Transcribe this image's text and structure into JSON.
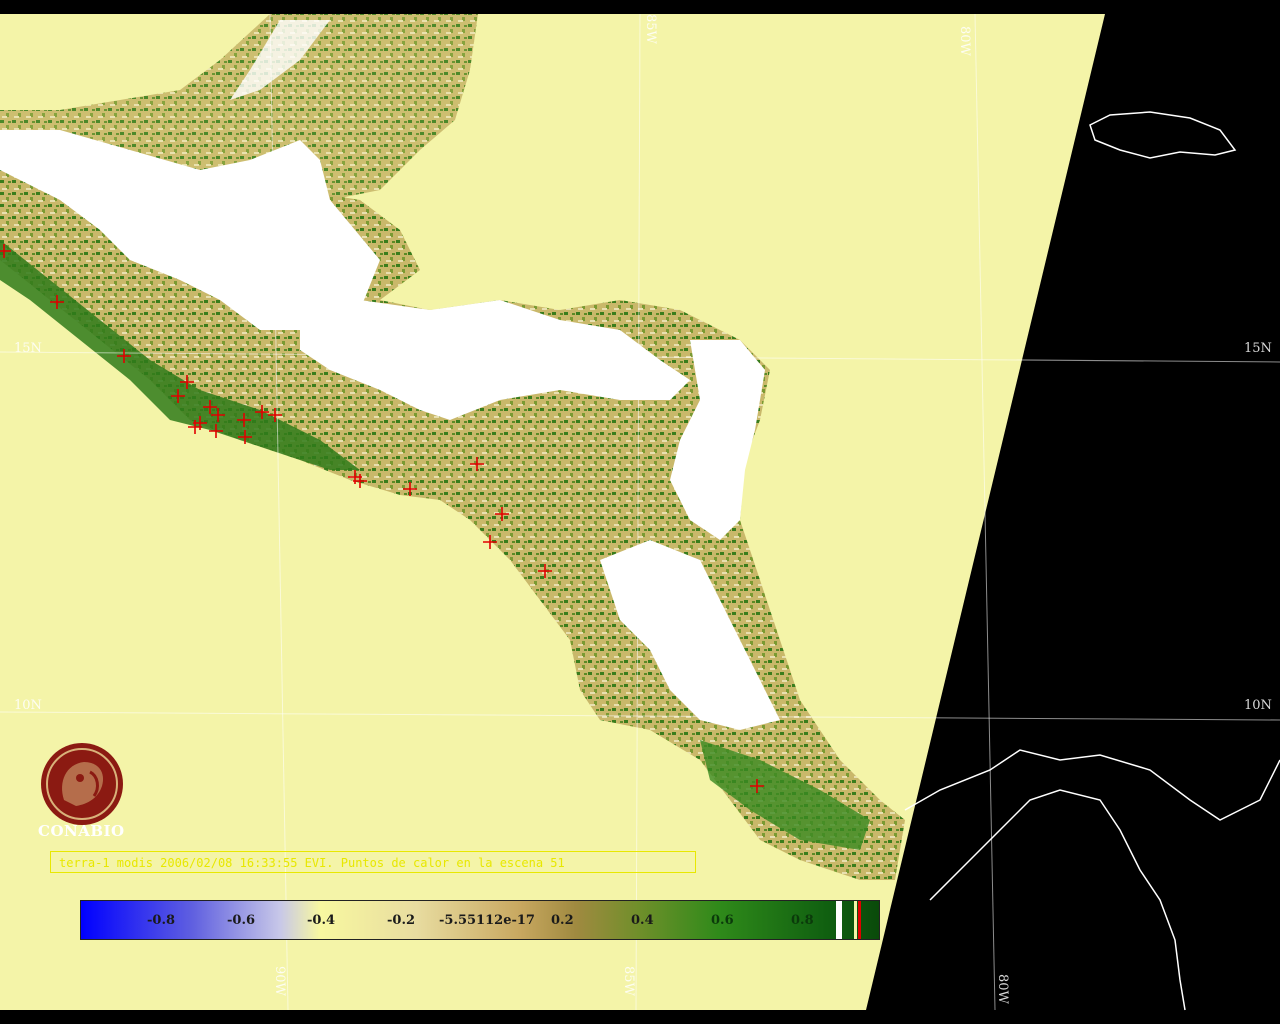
{
  "map": {
    "lat_labels": [
      "15N",
      "15N",
      "10N",
      "10N"
    ],
    "lon_labels": [
      "85W",
      "80W",
      "90W",
      "85W",
      "80W"
    ],
    "logo_text": "CONABIO",
    "caption": "terra-1 modis 2006/02/08 16:33:55 EVI. Puntos de calor en la escena 51",
    "colors": {
      "ocean": "#f4f4a8",
      "cloud": "#ffffff",
      "outside_swath": "#000000",
      "vegetation": "#3a7d1c",
      "hotspot": "#e00000",
      "logo": "#8b1a12"
    }
  },
  "legend": {
    "ticks": [
      "-0.8",
      "-0.6",
      "-0.4",
      "-0.2",
      "-5.55112e-17",
      "0.2",
      "0.4",
      "0.6",
      "0.8"
    ],
    "range": [
      -1,
      1
    ]
  }
}
